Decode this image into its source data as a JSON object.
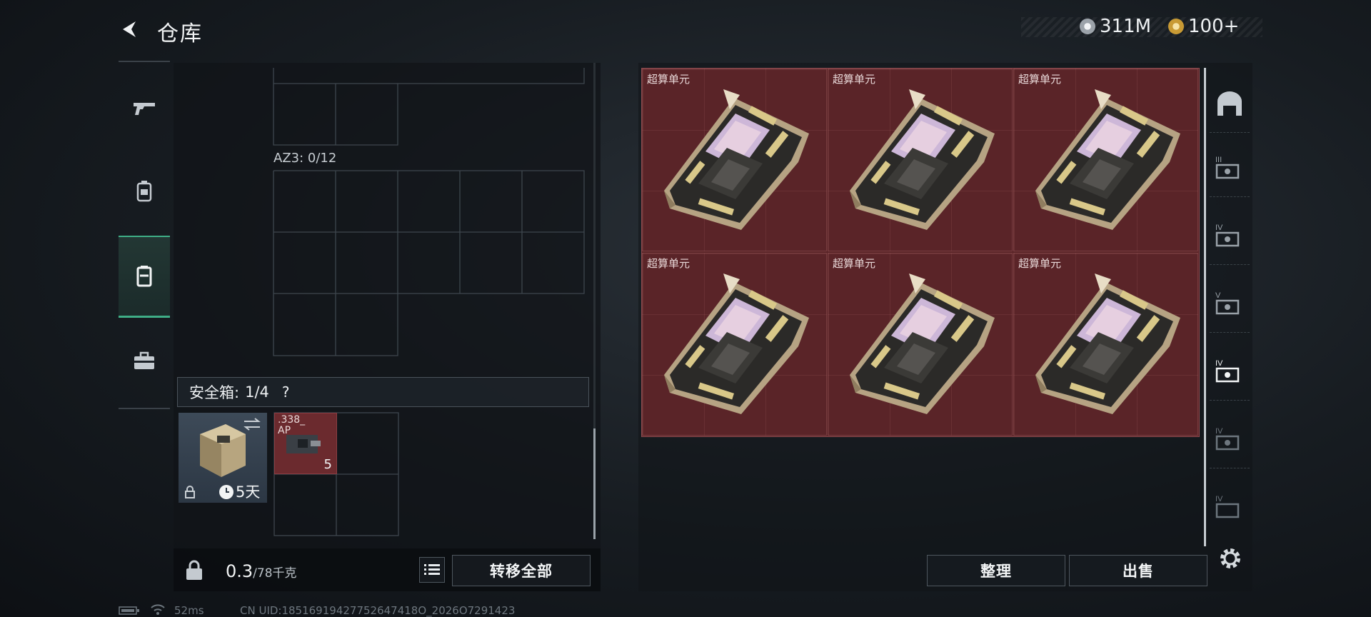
{
  "header": {
    "title": "仓库"
  },
  "currency": {
    "coins": "311M",
    "tickets": "100+",
    "coin_color": "#c9ced4",
    "ticket_color": "#d8b04e"
  },
  "rail": {
    "items": [
      {
        "icon": "gun-icon"
      },
      {
        "icon": "backpack-icon"
      },
      {
        "icon": "vest-icon",
        "active": true
      },
      {
        "icon": "toolbox-icon"
      }
    ]
  },
  "storage": {
    "az3_label": "AZ3: 0/12"
  },
  "safe_box": {
    "label": "安全箱:",
    "count": "1/4",
    "help": "?",
    "time_left": "5天"
  },
  "ammo": {
    "name": ".338_ AP",
    "count": "5"
  },
  "weight": {
    "current": "0.3",
    "max": "/78千克"
  },
  "buttons": {
    "transfer_all": "转移全部",
    "sort": "整理",
    "sell": "出售"
  },
  "items": [
    {
      "name": "超算单元"
    },
    {
      "name": "超算单元"
    },
    {
      "name": "超算单元"
    },
    {
      "name": "超算单元"
    },
    {
      "name": "超算单元"
    },
    {
      "name": "超算单元"
    }
  ],
  "side_tabs": [
    {
      "icon": "home-case-icon"
    },
    {
      "icon": "slot-iii-icon",
      "tag": "III"
    },
    {
      "icon": "slot-iv-icon",
      "tag": "IV"
    },
    {
      "icon": "slot-v-icon",
      "tag": "V"
    },
    {
      "icon": "slot-iv-active-icon",
      "tag": "IV"
    },
    {
      "icon": "slot-iv-b-icon",
      "tag": "IV"
    },
    {
      "icon": "slot-iv-c-icon",
      "tag": "IV"
    }
  ],
  "status": {
    "ping": "52ms",
    "uid": "CN UID:18516919427752647418O_2026O7291423"
  }
}
